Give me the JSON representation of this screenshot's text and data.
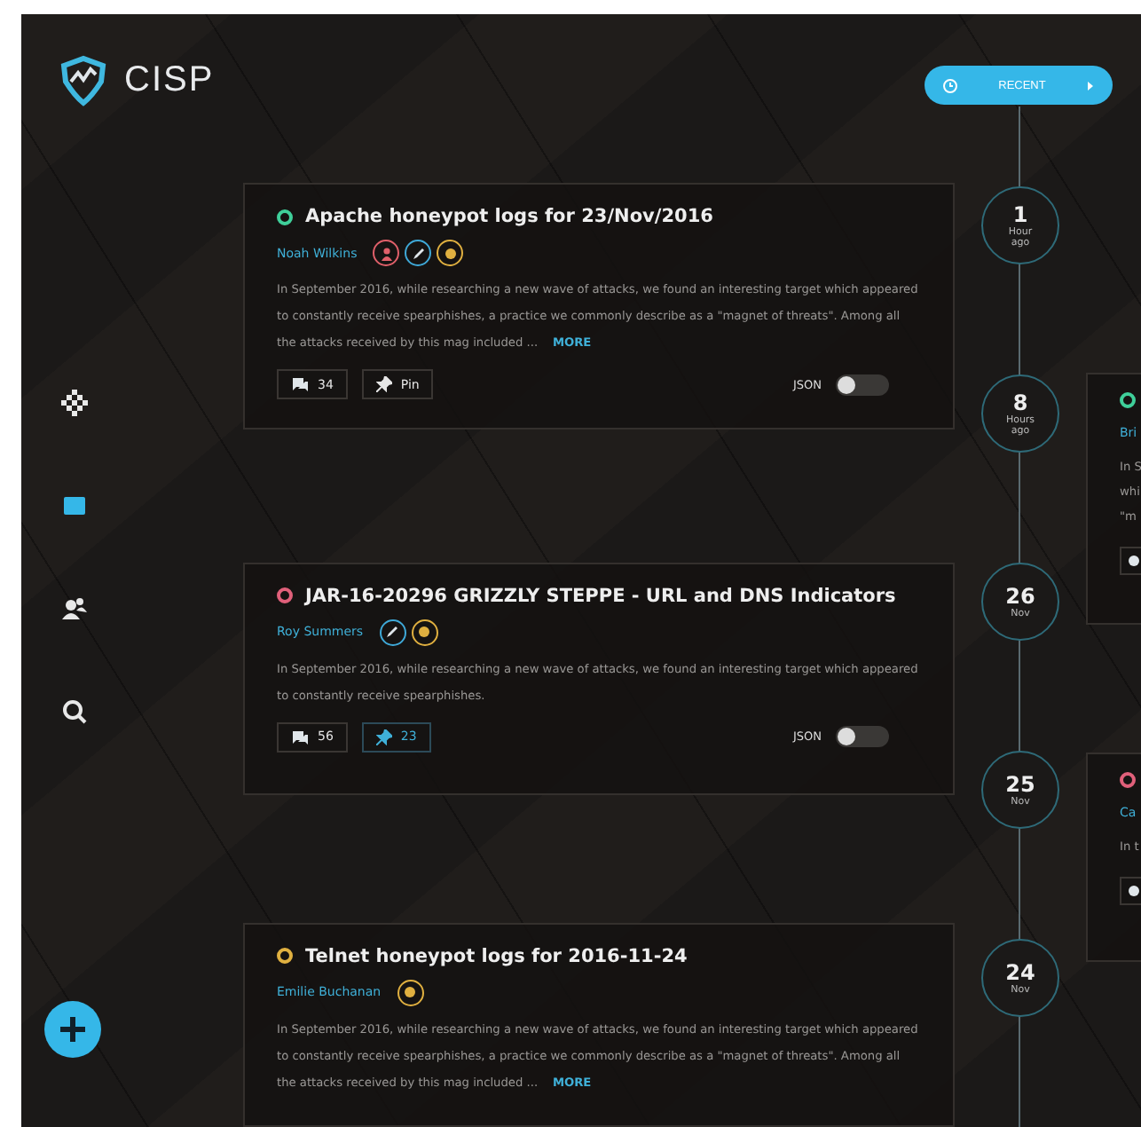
{
  "app": {
    "logo_text": "CISP"
  },
  "sidebar": {
    "items": [
      {
        "selected": false
      },
      {
        "selected": true
      },
      {
        "selected": false
      },
      {
        "selected": false
      }
    ]
  },
  "recent_button": {
    "label": "RECENT"
  },
  "posts": [
    {
      "title": "Apache honeypot logs for 23/Nov/2016",
      "color": "#3fcf9a",
      "author": "Noah Wilkins",
      "badges": [
        {
          "kind": "user",
          "color": "#e0606a"
        },
        {
          "kind": "pen",
          "color": "#3fa9d8"
        },
        {
          "kind": "coin",
          "color": "#e0b040"
        }
      ],
      "description": "In September 2016, while researching a new wave of attacks, we found an interesting target which appeared to constantly receive spearphishes, a practice we commonly describe as a \"magnet of threats\". Among all the attacks received by this mag included ...",
      "more": "MORE",
      "comments": "34",
      "pin": {
        "label": "Pin",
        "selected": false
      },
      "json_label": "JSON",
      "json_on": false
    },
    {
      "title": "JAR-16-20296 GRIZZLY STEPPE - URL and DNS Indicators",
      "color": "#e0607a",
      "author": "Roy Summers",
      "badges": [
        {
          "kind": "pen",
          "color": "#3fa9d8"
        },
        {
          "kind": "coin",
          "color": "#e0b040"
        }
      ],
      "description": "In September 2016, while researching a new wave of attacks, we found an interesting target which appeared to constantly receive spearphishes.",
      "comments": "56",
      "pin": {
        "label": "23",
        "selected": true
      },
      "json_label": "JSON",
      "json_on": false
    },
    {
      "title": "Telnet honeypot logs for 2016-11-24",
      "color": "#e0b040",
      "author": "Emilie Buchanan",
      "badges": [
        {
          "kind": "coin",
          "color": "#e0b040"
        }
      ],
      "description": "In September 2016, while researching a new wave of attacks, we found an interesting target which appeared to constantly receive spearphishes, a practice we commonly describe as a \"magnet of threats\". Among all the attacks received by this mag included ...",
      "more": "MORE"
    }
  ],
  "timeline": [
    {
      "value": "1",
      "unit": "Hour ago"
    },
    {
      "value": "8",
      "unit": "Hours ago"
    },
    {
      "value": "26",
      "unit": "Nov"
    },
    {
      "value": "25",
      "unit": "Nov"
    },
    {
      "value": "24",
      "unit": "Nov"
    }
  ],
  "side_posts": [
    {
      "color": "#3fcf9a",
      "author": "Bri",
      "description_lines": [
        "In S",
        "whi",
        "\"m"
      ]
    },
    {
      "color": "#e0607a",
      "author": "Ca",
      "description_lines": [
        "In t"
      ]
    }
  ]
}
